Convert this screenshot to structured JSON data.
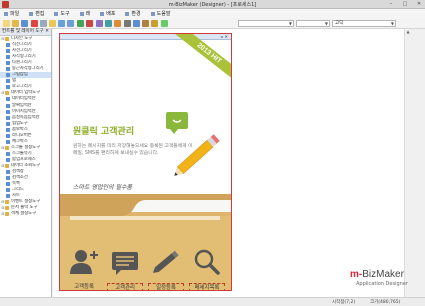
{
  "window": {
    "title": "m-BizMaker (Designer) - [프로세스1]"
  },
  "menu": [
    "파일",
    "편집",
    "도구",
    "레",
    "배포",
    "환경",
    "도움말"
  ],
  "toolbar": {
    "font_select": "",
    "font_select_label": "",
    "style_select": "고딕"
  },
  "panel": {
    "title": "컨트롤 및 레이어 도구",
    "items": [
      {
        "label": "디자인 도구",
        "level": "group"
      },
      {
        "label": "직선그리기",
        "level": "child"
      },
      {
        "label": "사선그리기",
        "level": "child"
      },
      {
        "label": "사각형그리기",
        "level": "child"
      },
      {
        "label": "타원그리기",
        "level": "child"
      },
      {
        "label": "둥근사각형그리기",
        "level": "child"
      },
      {
        "label": "그림삽입",
        "level": "child",
        "selected": true
      },
      {
        "label": "탭",
        "level": "child"
      },
      {
        "label": "로고그리기",
        "level": "child"
      },
      {
        "label": "데이터 입력도구",
        "level": "group"
      },
      {
        "label": "데이터입력란",
        "level": "child"
      },
      {
        "label": "날짜입력란",
        "level": "child"
      },
      {
        "label": "이미지입력란",
        "level": "child"
      },
      {
        "label": "음성녹음입력란",
        "level": "child"
      },
      {
        "label": "협업도구",
        "level": "child"
      },
      {
        "label": "콤보박스",
        "level": "child"
      },
      {
        "label": "라디오버튼",
        "level": "child"
      },
      {
        "label": "체크박스",
        "level": "child"
      },
      {
        "label": "스크롤 설정도구",
        "level": "group"
      },
      {
        "label": "스크롤뷰기",
        "level": "child"
      },
      {
        "label": "팝업프로세스",
        "level": "child"
      },
      {
        "label": "데이터 조회도구",
        "level": "group"
      },
      {
        "label": "검색창",
        "level": "child"
      },
      {
        "label": "검색조건",
        "level": "child"
      },
      {
        "label": "목록",
        "level": "child"
      },
      {
        "label": "그리드",
        "level": "child"
      },
      {
        "label": "차트",
        "level": "child"
      },
      {
        "label": "이벤트 설정도구",
        "level": "group"
      },
      {
        "label": "문서 출력 도구",
        "level": "group"
      },
      {
        "label": "객체 설정도구",
        "level": "group"
      }
    ]
  },
  "design": {
    "ribbon": "2013 HIT",
    "title": "원클릭 고객관리",
    "description": "원하는 메시지를 미리 저장해놓으세요 등록된 고객들에게 이메일, SMS를 편리하게 보내실수 있습니다.",
    "signature": "스마트 영업인의 필수품",
    "buttons": [
      "고객등록",
      "고객관리",
      "일정등록",
      "메세지목록"
    ]
  },
  "brand": {
    "name_prefix": "m-",
    "name_main": "BizMaker",
    "subtitle": "Application Designer"
  },
  "status": {
    "position": "시작점(7,2)",
    "size": "크기(480,765)"
  },
  "colors": {
    "accent_green": "#8fae2a",
    "folder": "#d8b46a",
    "selection": "#d03a3a",
    "brand_red": "#d12a3a"
  }
}
